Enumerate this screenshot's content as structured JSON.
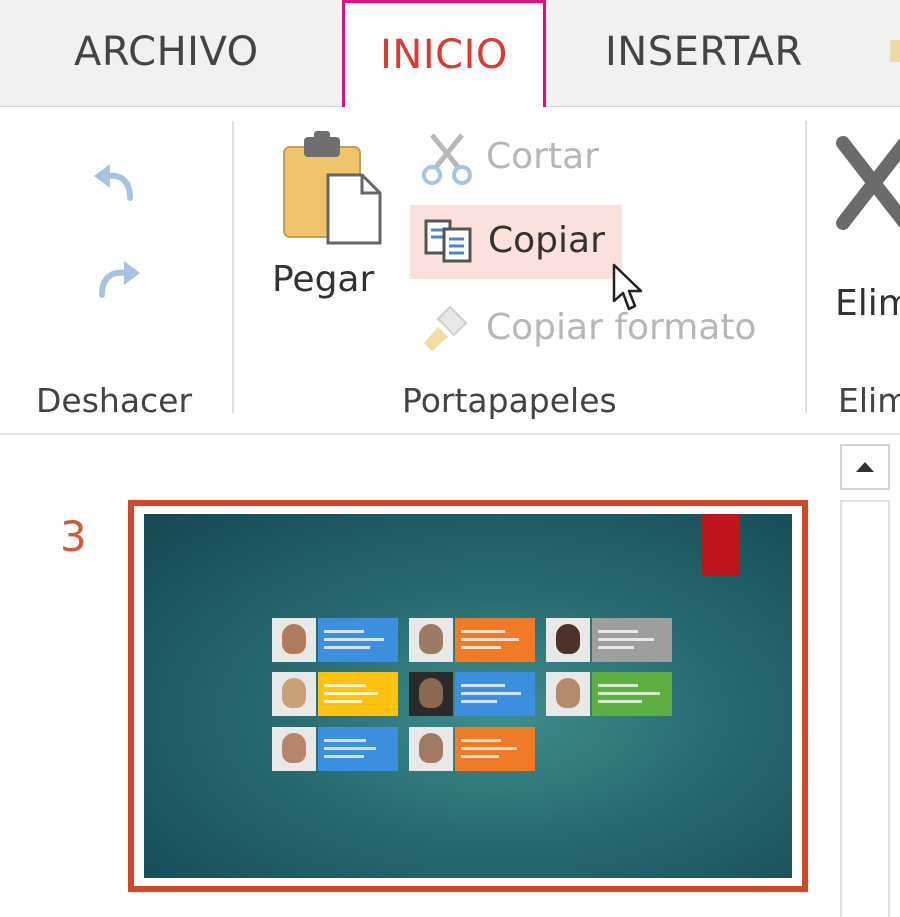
{
  "tabs": {
    "archivo": "ARCHIVO",
    "inicio": "INICIO",
    "insertar": "INSERTAR"
  },
  "ribbon": {
    "undo_group": {
      "label": "Deshacer"
    },
    "clipboard_group": {
      "label": "Portapapeles",
      "paste_label": "Pegar",
      "cut_label": "Cortar",
      "copy_label": "Copiar",
      "format_painter_label": "Copiar formato"
    },
    "delete_group": {
      "button_label": "Elim",
      "label": "Elim"
    }
  },
  "slides_panel": {
    "slide_number": "3"
  },
  "colors": {
    "accent_tab": "#d83b30",
    "highlight_border": "#e0107a",
    "selection_border": "#d24726",
    "copy_hover": "#fbe1dc",
    "card_colors": [
      "#3b8fde",
      "#f07a25",
      "#9e9e9e",
      "#ffc20e",
      "#3b8fde",
      "#5db040",
      "#3b8fde",
      "#f07a25"
    ]
  },
  "icons": [
    "undo-icon",
    "redo-icon",
    "clipboard-paste-icon",
    "scissors-icon",
    "copy-icon",
    "format-painter-icon",
    "delete-x-icon",
    "mouse-cursor-icon",
    "scroll-up-arrow-icon"
  ]
}
